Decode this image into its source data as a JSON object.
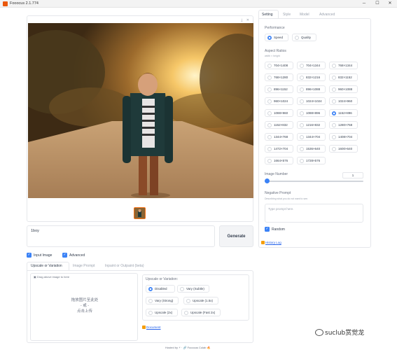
{
  "window": {
    "title": "Fooocus 2.1.774",
    "minimize": "─",
    "maximize": "☐",
    "close": "✕"
  },
  "gallery": {
    "corner_download": "⤓",
    "corner_close": "✕"
  },
  "prompt": {
    "value": "1boy",
    "generate_label": "Generate"
  },
  "toggles": {
    "input_image_label": "Input Image",
    "input_image_checked": true,
    "advanced_label": "Advanced",
    "advanced_checked": true
  },
  "input_tabs": [
    {
      "label": "Upscale or Variation",
      "active": true
    },
    {
      "label": "Image Prompt",
      "active": false
    },
    {
      "label": "Inpaint or Outpaint (beta)",
      "active": false
    }
  ],
  "drop_area": {
    "label": "Drag above image to here",
    "line1": "拖放图片至此处",
    "line2": "- 或 -",
    "line3": "点击上传"
  },
  "upscale": {
    "title": "Upscale or Variation:",
    "options": [
      {
        "label": "Disabled",
        "selected": true
      },
      {
        "label": "Vary (Subtle)",
        "selected": false
      },
      {
        "label": "Vary (Strong)",
        "selected": false
      },
      {
        "label": "Upscale (1.5x)",
        "selected": false
      },
      {
        "label": "Upscale (2x)",
        "selected": false
      },
      {
        "label": "Upscale (Fast 2x)",
        "selected": false
      }
    ],
    "document_link": "Document"
  },
  "footer": {
    "text": "Hosted by ⚡ · 🔗 Fooocus Colab 🔥"
  },
  "settings_tabs": [
    {
      "label": "Setting",
      "active": true
    },
    {
      "label": "Style",
      "active": false
    },
    {
      "label": "Model",
      "active": false
    },
    {
      "label": "Advanced",
      "active": false
    }
  ],
  "performance": {
    "label": "Performance",
    "options": [
      {
        "label": "Speed",
        "selected": true
      },
      {
        "label": "Quality",
        "selected": false
      }
    ]
  },
  "aspect_ratios": {
    "label": "Aspect Ratios",
    "sublabel": "width × height",
    "options": [
      {
        "label": "704×1408",
        "selected": false
      },
      {
        "label": "704×1344",
        "selected": false
      },
      {
        "label": "768×1344",
        "selected": false
      },
      {
        "label": "768×1280",
        "selected": false
      },
      {
        "label": "832×1216",
        "selected": false
      },
      {
        "label": "832×1152",
        "selected": false
      },
      {
        "label": "896×1152",
        "selected": false
      },
      {
        "label": "896×1088",
        "selected": false
      },
      {
        "label": "960×1088",
        "selected": false
      },
      {
        "label": "960×1024",
        "selected": false
      },
      {
        "label": "1024×1024",
        "selected": false
      },
      {
        "label": "1024×960",
        "selected": false
      },
      {
        "label": "1088×960",
        "selected": false
      },
      {
        "label": "1088×896",
        "selected": false
      },
      {
        "label": "1152×896",
        "selected": true
      },
      {
        "label": "1152×832",
        "selected": false
      },
      {
        "label": "1216×832",
        "selected": false
      },
      {
        "label": "1280×768",
        "selected": false
      },
      {
        "label": "1344×768",
        "selected": false
      },
      {
        "label": "1344×704",
        "selected": false
      },
      {
        "label": "1408×704",
        "selected": false
      },
      {
        "label": "1472×704",
        "selected": false
      },
      {
        "label": "1536×640",
        "selected": false
      },
      {
        "label": "1600×640",
        "selected": false
      },
      {
        "label": "1664×576",
        "selected": false
      },
      {
        "label": "1728×576",
        "selected": false
      }
    ]
  },
  "image_number": {
    "label": "Image Number",
    "value": "1",
    "fraction": 0.0
  },
  "negative_prompt": {
    "label": "Negative Prompt",
    "sublabel": "Describing what you do not want to see.",
    "placeholder": "Type prompt here."
  },
  "random": {
    "label": "Random",
    "checked": true
  },
  "history_link": "History Log",
  "watermark": "suclub赏觉龙",
  "colors": {
    "accent": "#3b82f6",
    "selected_border": "#f97316"
  }
}
